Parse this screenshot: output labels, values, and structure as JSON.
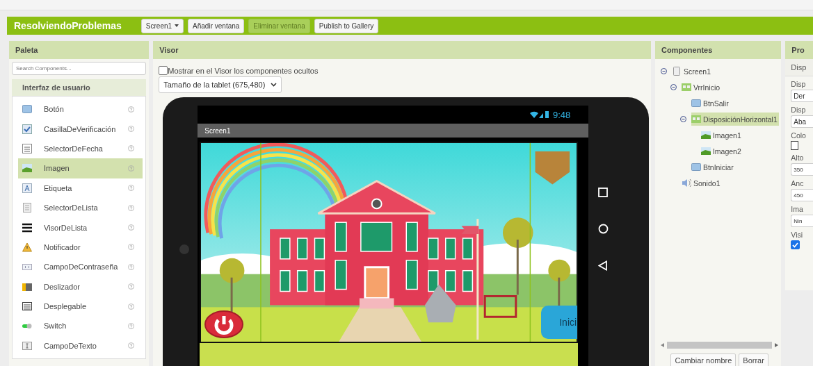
{
  "header": {
    "title": "ResolviendoProblemas",
    "buttons": [
      {
        "label": "Screen1",
        "kind": "dropdown",
        "disabled": false
      },
      {
        "label": "Añadir ventana",
        "kind": "button",
        "disabled": false
      },
      {
        "label": "Eliminar ventana",
        "kind": "button",
        "disabled": true
      },
      {
        "label": "Publish to Gallery",
        "kind": "button",
        "disabled": false
      }
    ]
  },
  "palette": {
    "title": "Paleta",
    "search": {
      "placeholder": "Search Components..."
    },
    "category": "Interfaz de usuario",
    "items": [
      {
        "label": "Botón",
        "kind": "button",
        "selected": false
      },
      {
        "label": "CasillaDeVerificación",
        "kind": "checkbox",
        "selected": false
      },
      {
        "label": "SelectorDeFecha",
        "kind": "date",
        "selected": false
      },
      {
        "label": "Imagen",
        "kind": "image",
        "selected": true
      },
      {
        "label": "Etiqueta",
        "kind": "label",
        "selected": false
      },
      {
        "label": "SelectorDeLista",
        "kind": "listpicker",
        "selected": false
      },
      {
        "label": "VisorDeLista",
        "kind": "listview",
        "selected": false
      },
      {
        "label": "Notificador",
        "kind": "notifier",
        "selected": false
      },
      {
        "label": "CampoDeContraseña",
        "kind": "password",
        "selected": false
      },
      {
        "label": "Deslizador",
        "kind": "slider",
        "selected": false
      },
      {
        "label": "Desplegable",
        "kind": "spinner",
        "selected": false
      },
      {
        "label": "Switch",
        "kind": "switch",
        "selected": false
      },
      {
        "label": "CampoDeTexto",
        "kind": "textbox",
        "selected": false
      }
    ]
  },
  "viewer": {
    "title": "Visor",
    "show_hidden": {
      "label": "Mostrar en el Visor los componentes ocultos",
      "checked": false
    },
    "size_select": "Tamaño de la tablet (675,480)",
    "device": {
      "time": "9:48",
      "screen_title": "Screen1",
      "start_button": "Inici"
    }
  },
  "components": {
    "title": "Componentes",
    "tree": [
      {
        "label": "Screen1",
        "kind": "screen",
        "expanded": true,
        "selected": false,
        "children": [
          {
            "label": "VrrInicio",
            "kind": "arrangement",
            "expanded": true,
            "selected": false,
            "children": [
              {
                "label": "BtnSalir",
                "kind": "button",
                "selected": false
              },
              {
                "label": "DisposiciónHorizontal1",
                "kind": "arrangement",
                "expanded": true,
                "selected": true,
                "children": [
                  {
                    "label": "Imagen1",
                    "kind": "image",
                    "selected": false
                  },
                  {
                    "label": "Imagen2",
                    "kind": "image",
                    "selected": false
                  }
                ]
              },
              {
                "label": "BtnIniciar",
                "kind": "button",
                "selected": false
              }
            ]
          },
          {
            "label": "Sonido1",
            "kind": "sound",
            "selected": false
          }
        ]
      }
    ],
    "buttons": [
      "Cambiar nombre",
      "Borrar"
    ]
  },
  "properties": {
    "title": "Pro",
    "section": "Disp",
    "fields": [
      {
        "label": "Disp",
        "kind": "select",
        "value": "Der"
      },
      {
        "label": "Disp",
        "kind": "select",
        "value": "Aba"
      },
      {
        "label": "Colo",
        "kind": "color"
      },
      {
        "label": "Alto",
        "kind": "text",
        "value": "350"
      },
      {
        "label": "Anc",
        "kind": "text",
        "value": "450"
      },
      {
        "label": "Ima",
        "kind": "text",
        "value": "Nin"
      },
      {
        "label": "Visi",
        "kind": "checkbox",
        "checked": true
      }
    ]
  }
}
